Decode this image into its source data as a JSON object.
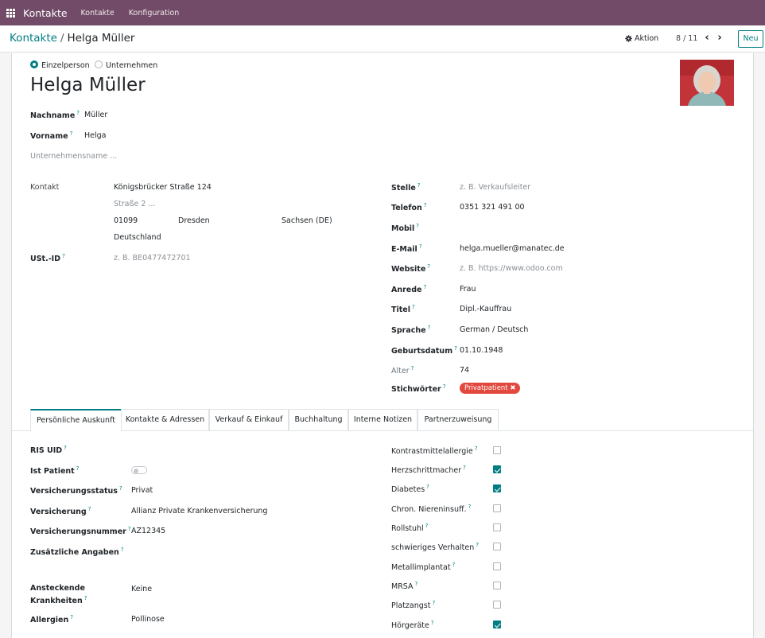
{
  "topbar": {
    "app_name": "Kontakte",
    "menu": [
      "Kontakte",
      "Konfiguration"
    ]
  },
  "control_panel": {
    "breadcrumb_parent": "Kontakte",
    "breadcrumb_separator": "/",
    "breadcrumb_current": "Helga Müller",
    "action_label": "Aktion",
    "pager": "8 / 11",
    "new_label": "Neu"
  },
  "form": {
    "company_type": {
      "options": [
        "Einzelperson",
        "Unternehmen"
      ],
      "selected": "Einzelperson"
    },
    "name": "Helga Müller",
    "nachname": {
      "label": "Nachname",
      "value": "Müller"
    },
    "vorname": {
      "label": "Vorname",
      "value": "Helga"
    },
    "company_placeholder": "Unternehmensname ...",
    "address": {
      "label": "Kontakt",
      "street": "Königsbrücker Straße 124",
      "street2_placeholder": "Straße 2 ...",
      "zip": "01099",
      "city": "Dresden",
      "state": "Sachsen (DE)",
      "country": "Deutschland"
    },
    "vat": {
      "label": "USt.-ID",
      "placeholder": "z. B. BE0477472701"
    },
    "right_fields": [
      {
        "label": "Stelle",
        "value": "z. B. Verkaufsleiter",
        "placeholder": true
      },
      {
        "label": "Telefon",
        "value": "0351 321 491 00"
      },
      {
        "label": "Mobil",
        "value": ""
      },
      {
        "label": "E-Mail",
        "value": "helga.mueller@manatec.de"
      },
      {
        "label": "Website",
        "value": "z. B. https://www.odoo.com",
        "placeholder": true
      },
      {
        "label": "Anrede",
        "value": "Frau"
      },
      {
        "label": "Titel",
        "value": "Dipl.-Kauffrau"
      },
      {
        "label": "Sprache",
        "value": "German / Deutsch"
      },
      {
        "label": "Geburtsdatum",
        "value": "01.10.1948"
      },
      {
        "label": "Alter",
        "value": "74"
      },
      {
        "label": "Stichwörter",
        "tag": "Privatpatient"
      }
    ],
    "help_mark": "?",
    "tag_remove": "✖"
  },
  "tabs": [
    "Persönliche Auskunft",
    "Kontakte & Adressen",
    "Verkauf & Einkauf",
    "Buchhaltung",
    "Interne Notizen",
    "Partnerzuweisung"
  ],
  "personal": {
    "left": [
      {
        "label": "RIS UID",
        "value": ""
      },
      {
        "label": "Ist Patient",
        "toggle": false
      },
      {
        "label": "Versicherungsstatus",
        "value": "Privat"
      },
      {
        "label": "Versicherung",
        "value": "Allianz Private Krankenversicherung"
      },
      {
        "label": "Versicherungsnummer",
        "value": "AZ12345"
      },
      {
        "label": "Zusätzliche Angaben",
        "value": ""
      },
      {
        "label_lines": [
          "Ansteckende",
          "Krankheiten"
        ],
        "value": "Keine"
      },
      {
        "label": "Allergien",
        "value": "Pollinose"
      }
    ],
    "right": [
      {
        "label": "Kontrastmittelallergie",
        "checked": false
      },
      {
        "label": "Herzschrittmacher",
        "checked": true
      },
      {
        "label": "Diabetes",
        "checked": true
      },
      {
        "label": "Chron. Niereninsuff.",
        "checked": false
      },
      {
        "label": "Rollstuhl",
        "checked": false
      },
      {
        "label": "schwieriges Verhalten",
        "checked": false
      },
      {
        "label": "Metallimplantat",
        "checked": false
      },
      {
        "label": "MRSA",
        "checked": false
      },
      {
        "label": "Platzangst",
        "checked": false
      },
      {
        "label": "Hörgeräte",
        "checked": true
      }
    ]
  },
  "colors": {
    "brand": "#714b67",
    "accent": "#017e84",
    "tag": "#e2483d"
  }
}
